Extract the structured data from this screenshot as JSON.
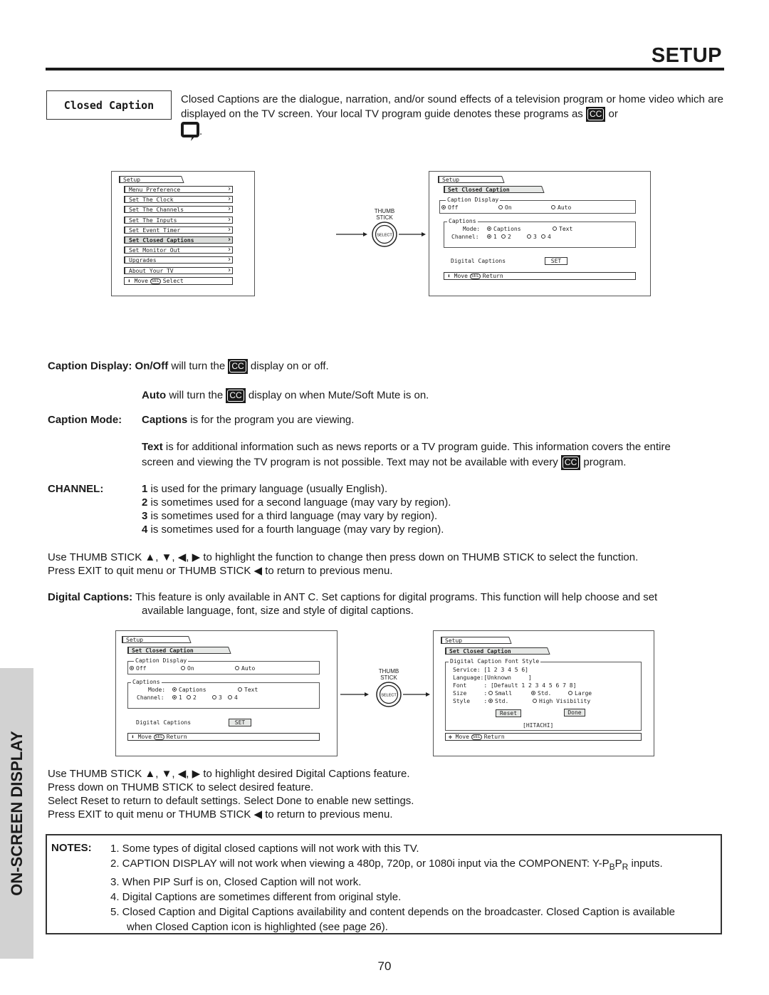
{
  "header": {
    "title": "SETUP"
  },
  "side_tab": {
    "label": "ON-SCREEN DISPLAY"
  },
  "section": {
    "title": "Closed Caption",
    "intro_text": "Closed Captions are the dialogue, narration, and/or sound effects of a television program or home video which are displayed on the TV screen.  Your local TV program guide denotes these programs as",
    "intro_or": "or",
    "intro_end": ".",
    "icons": [
      "cc-icon",
      "speech-bubble-icon"
    ]
  },
  "cc_icon_text": "CC",
  "menus": {
    "setup_main": {
      "tab": "Setup",
      "items": [
        "Menu Preference",
        "Set The Clock",
        "Set The Channels",
        "Set The Inputs",
        "Set Event Timer",
        "Set Closed Captions",
        "Set Monitor Out",
        "Upgrades",
        "About Your TV"
      ],
      "highlighted": "Set Closed Captions",
      "status_move": "Move",
      "status_key": "SEL",
      "status_action": "Select"
    },
    "closed_caption": {
      "tab": "Setup",
      "subtab": "Set Closed Caption",
      "caption_display": {
        "legend": "Caption Display",
        "options": [
          "Off",
          "On",
          "Auto"
        ],
        "selected": "Off"
      },
      "captions": {
        "legend": "Captions",
        "mode_label": "Mode:",
        "mode_options": [
          "Captions",
          "Text"
        ],
        "mode_selected": "Captions",
        "channel_label": "Channel:",
        "channel_options": [
          "1",
          "2",
          "3",
          "4"
        ],
        "channel_selected": "1"
      },
      "digital_captions_label": "Digital Captions",
      "set_button": "SET",
      "status_move": "Move",
      "status_key": "SEL",
      "status_action": "Return"
    },
    "digital_font_style": {
      "tab": "Setup",
      "subtab": "Set Closed Caption",
      "legend": "Digital Caption Font Style",
      "service_label": "Service:",
      "service_value": "[1 2 3 4 5 6]",
      "language_label": "Language:",
      "language_value": "[Unknown     ]",
      "font_label": "Font     :",
      "font_value": "[Default 1 2 3 4 5 6 7 8]",
      "size_label": "Size     :",
      "size_options": [
        "Small",
        "Std.",
        "Large"
      ],
      "size_selected": "Std.",
      "style_label": "Style    :",
      "style_options": [
        "Std.",
        "High Visibility"
      ],
      "style_selected": "Std.",
      "reset_button": "Reset",
      "done_button": "Done",
      "brand": "[HITACHI]",
      "status_move": "Move",
      "status_key": "SEL",
      "status_action": "Return"
    }
  },
  "thumb_stick": {
    "line1": "THUMB",
    "line2": "STICK",
    "button": "SELECT"
  },
  "descriptions": {
    "caption_display_label": "Caption Display:",
    "onoff_bold": "On/Off",
    "onoff_pre": " will turn the ",
    "onoff_post": " display on or off.",
    "auto_bold": "Auto",
    "auto_pre": " will turn the ",
    "auto_post": " display on when Mute/Soft Mute is on.",
    "caption_mode_label": "Caption Mode:",
    "captions_bold": "Captions",
    "captions_text": " is for the program you are viewing.",
    "text_bold": "Text",
    "text_line1": " is for additional information such as news reports or a TV program guide.  This information covers the entire",
    "text_line2_pre": "screen and viewing the TV program is not possible.  Text may not be available with every ",
    "text_line2_post": " program.",
    "channel_label": "CHANNEL:",
    "channels": [
      {
        "num": "1",
        "text": " is used for the primary language (usually English)."
      },
      {
        "num": "2",
        "text": " is sometimes used for a second language (may vary by region)."
      },
      {
        "num": "3",
        "text": " is sometimes used for a third language (may vary by region)."
      },
      {
        "num": "4",
        "text": " is sometimes used for a fourth language (may vary by region)."
      }
    ],
    "nav1_line1": "Use THUMB STICK ▲, ▼, ◀, ▶ to highlight the function to change then press down on THUMB STICK to select the function.",
    "nav1_line2": "Press EXIT to quit menu or THUMB STICK ◀ to return to previous menu.",
    "digital_label": "Digital Captions:",
    "digital_line1": " This feature is only available in ANT C.  Set captions for digital programs.  This function will help choose and set",
    "digital_line2": "available language, font, size and style of digital captions.",
    "nav2": [
      "Use THUMB STICK ▲, ▼, ◀, ▶ to highlight desired Digital Captions feature.",
      "Press down on THUMB STICK to select desired feature.",
      "Select Reset to return to default settings.  Select Done to enable new settings.",
      "Press EXIT to quit menu or THUMB STICK ◀ to return to previous menu."
    ]
  },
  "notes": {
    "label": "NOTES:",
    "items": [
      "1.  Some types of digital closed captions will not work with this TV.",
      "2.  CAPTION DISPLAY will not work when viewing a 480p, 720p, or 1080i input via the COMPONENT: Y-P",
      "3.  When PIP Surf is on, Closed Caption will not work.",
      "4.  Digital Captions are sometimes different from original style.",
      "5.  Closed Caption and Digital Captions availability and content depends on the broadcaster.  Closed Caption is available",
      "when Closed Caption icon is highlighted (see page 26)."
    ],
    "note2_sub_b": "B",
    "note2_p": "P",
    "note2_sub_r": "R",
    "note2_end": " inputs."
  },
  "page_number": "70"
}
